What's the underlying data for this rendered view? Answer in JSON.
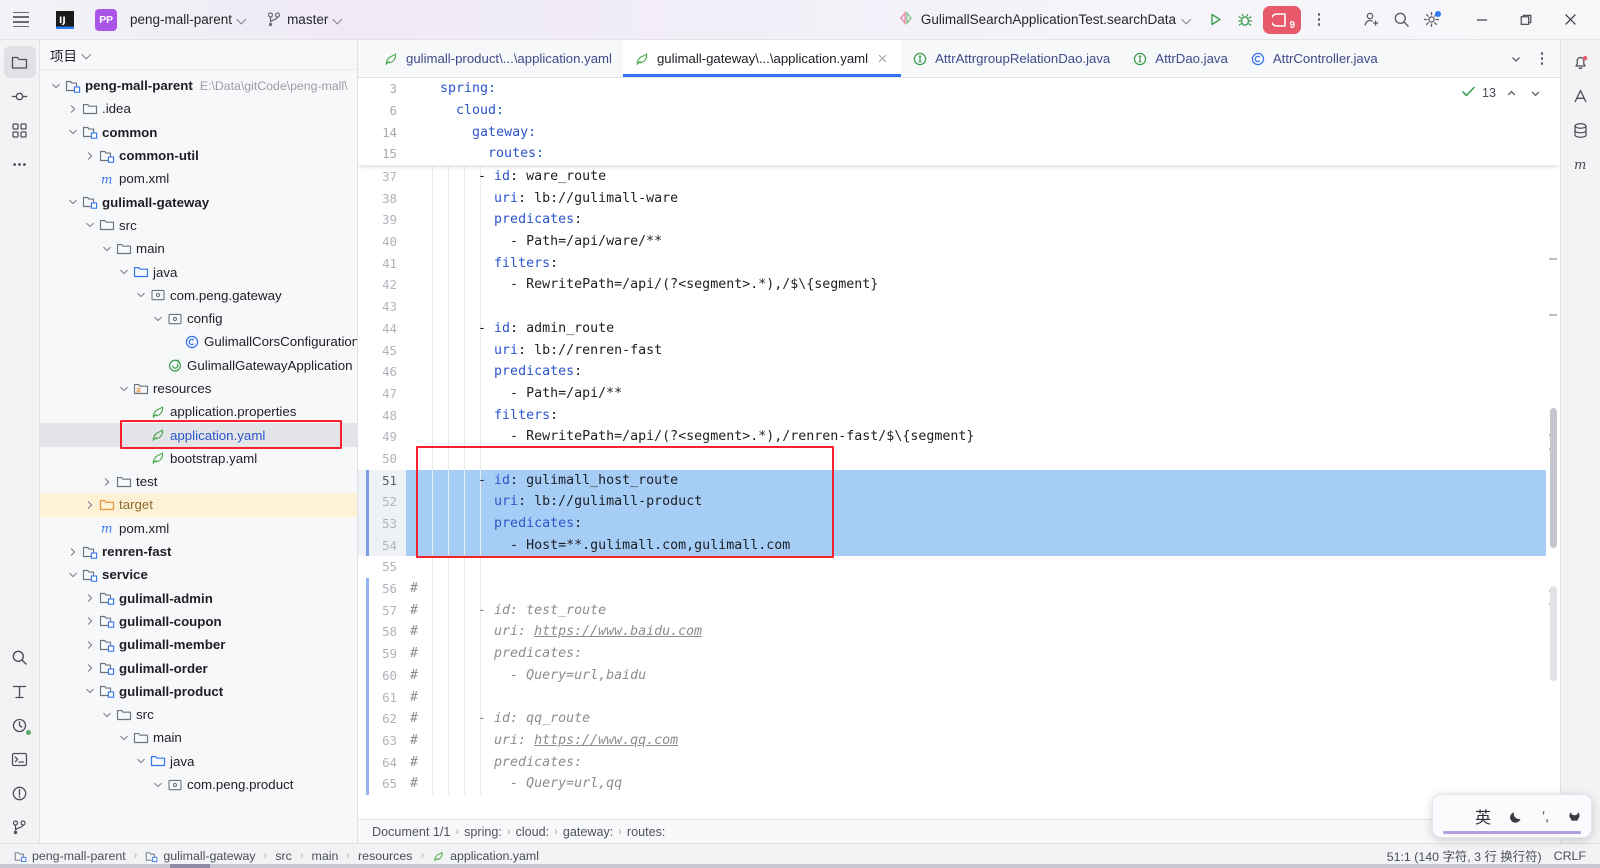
{
  "titlebar": {
    "logo": "intellij-idea-logo",
    "menu_icon": "hamburger-menu-icon",
    "project_badge": "PP",
    "project_name": "peng-mall-parent",
    "branch_icon": "git-branch-icon",
    "branch_name": "master",
    "run_config": "GulimallSearchApplicationTest.searchData",
    "run_icon": "run-icon",
    "debug_icon": "debug-icon",
    "services_badge": "9",
    "more_icon": "more-vertical-icon",
    "add_user_icon": "add-user-icon",
    "search_icon": "search-icon",
    "settings_icon": "gear-icon",
    "minimize": "minimize-icon",
    "maximize": "maximize-icon",
    "close": "close-icon"
  },
  "rail": {
    "top": [
      "project-icon",
      "commit-icon",
      "structure-icon",
      "more-tools-icon"
    ],
    "bottom": [
      "search-everywhere-icon",
      "refactor-icon",
      "build-icon",
      "terminal-icon",
      "problems-icon",
      "version-control-icon"
    ]
  },
  "rail_right": {
    "items": [
      "notifications-icon",
      "ai-assistant-icon",
      "database-icon",
      "maven-icon"
    ]
  },
  "tool_window": {
    "title": "项目",
    "chevron": "chevron-down-icon"
  },
  "tree": [
    {
      "depth": 0,
      "twist": "down",
      "icon": "module",
      "label": "peng-mall-parent",
      "bold": true,
      "path": "E:\\Data\\gitCode\\peng-mall\\"
    },
    {
      "depth": 1,
      "twist": "right",
      "icon": "folder",
      "label": ".idea",
      "bold": false,
      "path": ""
    },
    {
      "depth": 1,
      "twist": "down",
      "icon": "module",
      "label": "common",
      "bold": true,
      "path": ""
    },
    {
      "depth": 2,
      "twist": "right",
      "icon": "module",
      "label": "common-util",
      "bold": true,
      "path": ""
    },
    {
      "depth": 2,
      "twist": "none",
      "icon": "maven",
      "label": "pom.xml",
      "bold": false,
      "path": ""
    },
    {
      "depth": 1,
      "twist": "down",
      "icon": "module",
      "label": "gulimall-gateway",
      "bold": true,
      "path": ""
    },
    {
      "depth": 2,
      "twist": "down",
      "icon": "folder",
      "label": "src",
      "bold": false,
      "path": ""
    },
    {
      "depth": 3,
      "twist": "down",
      "icon": "folder",
      "label": "main",
      "bold": false,
      "path": ""
    },
    {
      "depth": 4,
      "twist": "down",
      "icon": "srcroot",
      "label": "java",
      "bold": false,
      "path": ""
    },
    {
      "depth": 5,
      "twist": "down",
      "icon": "package",
      "label": "com.peng.gateway",
      "bold": false,
      "path": ""
    },
    {
      "depth": 6,
      "twist": "down",
      "icon": "package",
      "label": "config",
      "bold": false,
      "path": ""
    },
    {
      "depth": 7,
      "twist": "none",
      "icon": "class",
      "label": "GulimallCorsConfiguration",
      "bold": false,
      "path": ""
    },
    {
      "depth": 6,
      "twist": "none",
      "icon": "springboot",
      "label": "GulimallGatewayApplication",
      "bold": false,
      "path": ""
    },
    {
      "depth": 4,
      "twist": "down",
      "icon": "resroot",
      "label": "resources",
      "bold": false,
      "path": ""
    },
    {
      "depth": 5,
      "twist": "none",
      "icon": "yaml",
      "label": "application.properties",
      "bold": false,
      "path": ""
    },
    {
      "depth": 5,
      "twist": "none",
      "icon": "yaml",
      "label": "application.yaml",
      "bold": false,
      "path": "",
      "state": "selected"
    },
    {
      "depth": 5,
      "twist": "none",
      "icon": "yaml",
      "label": "bootstrap.yaml",
      "bold": false,
      "path": ""
    },
    {
      "depth": 3,
      "twist": "right",
      "icon": "folder",
      "label": "test",
      "bold": false,
      "path": ""
    },
    {
      "depth": 2,
      "twist": "right",
      "icon": "excluded",
      "label": "target",
      "bold": false,
      "path": "",
      "state": "target"
    },
    {
      "depth": 2,
      "twist": "none",
      "icon": "maven",
      "label": "pom.xml",
      "bold": false,
      "path": ""
    },
    {
      "depth": 1,
      "twist": "right",
      "icon": "module",
      "label": "renren-fast",
      "bold": true,
      "path": ""
    },
    {
      "depth": 1,
      "twist": "down",
      "icon": "module",
      "label": "service",
      "bold": true,
      "path": ""
    },
    {
      "depth": 2,
      "twist": "right",
      "icon": "module",
      "label": "gulimall-admin",
      "bold": true,
      "path": ""
    },
    {
      "depth": 2,
      "twist": "right",
      "icon": "module",
      "label": "gulimall-coupon",
      "bold": true,
      "path": ""
    },
    {
      "depth": 2,
      "twist": "right",
      "icon": "module",
      "label": "gulimall-member",
      "bold": true,
      "path": ""
    },
    {
      "depth": 2,
      "twist": "right",
      "icon": "module",
      "label": "gulimall-order",
      "bold": true,
      "path": ""
    },
    {
      "depth": 2,
      "twist": "down",
      "icon": "module",
      "label": "gulimall-product",
      "bold": true,
      "path": ""
    },
    {
      "depth": 3,
      "twist": "down",
      "icon": "folder",
      "label": "src",
      "bold": false,
      "path": ""
    },
    {
      "depth": 4,
      "twist": "down",
      "icon": "folder",
      "label": "main",
      "bold": false,
      "path": ""
    },
    {
      "depth": 5,
      "twist": "down",
      "icon": "srcroot",
      "label": "java",
      "bold": false,
      "path": ""
    },
    {
      "depth": 6,
      "twist": "down",
      "icon": "package",
      "label": "com.peng.product",
      "bold": false,
      "path": ""
    }
  ],
  "tabs": [
    {
      "icon": "yaml-icon",
      "label": "gulimall-product\\...\\application.yaml",
      "active": false,
      "closable": false
    },
    {
      "icon": "yaml-icon",
      "label": "gulimall-gateway\\...\\application.yaml",
      "active": true,
      "closable": true
    },
    {
      "icon": "interface-icon",
      "label": "AttrAttrgroupRelationDao.java",
      "active": false,
      "closable": false
    },
    {
      "icon": "interface-icon",
      "label": "AttrDao.java",
      "active": false,
      "closable": false
    },
    {
      "icon": "class-icon",
      "label": "AttrController.java",
      "active": false,
      "closable": false
    }
  ],
  "tab_controls": {
    "chevron": "chevron-down-icon",
    "more": "more-vertical-icon"
  },
  "inspection": {
    "icon": "inspection-check-icon",
    "count": "13",
    "up": "chevron-up-icon",
    "down": "chevron-down-icon"
  },
  "sticky_lines": [
    {
      "num": "3",
      "text": "spring:",
      "indent": 2
    },
    {
      "num": "6",
      "text": "cloud:",
      "indent": 4
    },
    {
      "num": "14",
      "text": "gateway:",
      "indent": 6
    },
    {
      "num": "15",
      "text": "routes:",
      "indent": 8
    }
  ],
  "code_lines": [
    {
      "num": "37",
      "text": "      - id: ware_route",
      "key": "id",
      "selected": false,
      "comment": false
    },
    {
      "num": "38",
      "text": "        uri: lb://gulimall-ware",
      "key": "uri",
      "selected": false,
      "comment": false
    },
    {
      "num": "39",
      "text": "        predicates:",
      "key": "predicates",
      "selected": false,
      "comment": false
    },
    {
      "num": "40",
      "text": "          - Path=/api/ware/**",
      "key": "",
      "selected": false,
      "comment": false
    },
    {
      "num": "41",
      "text": "        filters:",
      "key": "filters",
      "selected": false,
      "comment": false
    },
    {
      "num": "42",
      "text": "          - RewritePath=/api/(?<segment>.*),/$\\{segment}",
      "key": "",
      "selected": false,
      "comment": false
    },
    {
      "num": "43",
      "text": "",
      "key": "",
      "selected": false,
      "comment": false
    },
    {
      "num": "44",
      "text": "      - id: admin_route",
      "key": "id",
      "selected": false,
      "comment": false
    },
    {
      "num": "45",
      "text": "        uri: lb://renren-fast",
      "key": "uri",
      "selected": false,
      "comment": false
    },
    {
      "num": "46",
      "text": "        predicates:",
      "key": "predicates",
      "selected": false,
      "comment": false
    },
    {
      "num": "47",
      "text": "          - Path=/api/**",
      "key": "",
      "selected": false,
      "comment": false
    },
    {
      "num": "48",
      "text": "        filters:",
      "key": "filters",
      "selected": false,
      "comment": false
    },
    {
      "num": "49",
      "text": "          - RewritePath=/api/(?<segment>.*),/renren-fast/$\\{segment}",
      "key": "",
      "selected": false,
      "comment": false
    },
    {
      "num": "50",
      "text": "",
      "key": "",
      "selected": false,
      "comment": false
    },
    {
      "num": "51",
      "text": "      - id: gulimall_host_route",
      "key": "id",
      "selected": true,
      "comment": false
    },
    {
      "num": "52",
      "text": "        uri: lb://gulimall-product",
      "key": "uri",
      "selected": true,
      "comment": false
    },
    {
      "num": "53",
      "text": "        predicates:",
      "key": "predicates",
      "selected": true,
      "comment": false
    },
    {
      "num": "54",
      "text": "          - Host=**.gulimall.com,gulimall.com",
      "key": "",
      "selected": true,
      "comment": false
    },
    {
      "num": "55",
      "text": "",
      "key": "",
      "selected": false,
      "comment": false
    },
    {
      "num": "56",
      "text": "",
      "key": "",
      "selected": false,
      "comment": true,
      "hash": "#"
    },
    {
      "num": "57",
      "text": "      - id: test_route",
      "key": "",
      "selected": false,
      "comment": true,
      "hash": "#"
    },
    {
      "num": "58",
      "text": "        uri: https://www.baidu.com",
      "key": "",
      "selected": false,
      "comment": true,
      "hash": "#",
      "link": "https://www.baidu.com"
    },
    {
      "num": "59",
      "text": "        predicates:",
      "key": "",
      "selected": false,
      "comment": true,
      "hash": "#"
    },
    {
      "num": "60",
      "text": "          - Query=url,baidu",
      "key": "",
      "selected": false,
      "comment": true,
      "hash": "#"
    },
    {
      "num": "61",
      "text": "",
      "key": "",
      "selected": false,
      "comment": true,
      "hash": "#"
    },
    {
      "num": "62",
      "text": "      - id: qq_route",
      "key": "",
      "selected": false,
      "comment": true,
      "hash": "#"
    },
    {
      "num": "63",
      "text": "        uri: https://www.qq.com",
      "key": "",
      "selected": false,
      "comment": true,
      "hash": "#",
      "link": "https://www.qq.com"
    },
    {
      "num": "64",
      "text": "        predicates:",
      "key": "",
      "selected": false,
      "comment": true,
      "hash": "#"
    },
    {
      "num": "65",
      "text": "          - Query=url,qq",
      "key": "",
      "selected": false,
      "comment": true,
      "hash": "#"
    }
  ],
  "breadcrumbs": [
    "Document 1/1",
    "spring:",
    "cloud:",
    "gateway:",
    "routes:"
  ],
  "status_bar": {
    "left": [
      {
        "icon": "module-icon",
        "label": "peng-mall-parent"
      },
      {
        "icon": "module-icon",
        "label": "gulimall-gateway"
      },
      {
        "icon": "",
        "label": "src"
      },
      {
        "icon": "",
        "label": "main"
      },
      {
        "icon": "",
        "label": "resources"
      },
      {
        "icon": "yaml-icon",
        "label": "application.yaml"
      }
    ],
    "caret": "51:1 (140 字符, 3 行 换行符)",
    "line_ending": "CRLF"
  },
  "ime_bar": {
    "windows_icon": "windows-icon",
    "mode": "英",
    "moon_icon": "moon-icon",
    "punct_icon": "punctuation-icon",
    "hat_icon": "hat-icon"
  },
  "colors": {
    "accent": "#3574F0",
    "selection": "#A6CDF5",
    "annotation": "#F5222D",
    "keyword": "#2B55C9",
    "comment": "#8C8C8C",
    "target_highlight": "#FDF2D5",
    "badge_purple": "#A855E8",
    "debug_red": "#E8596B"
  }
}
